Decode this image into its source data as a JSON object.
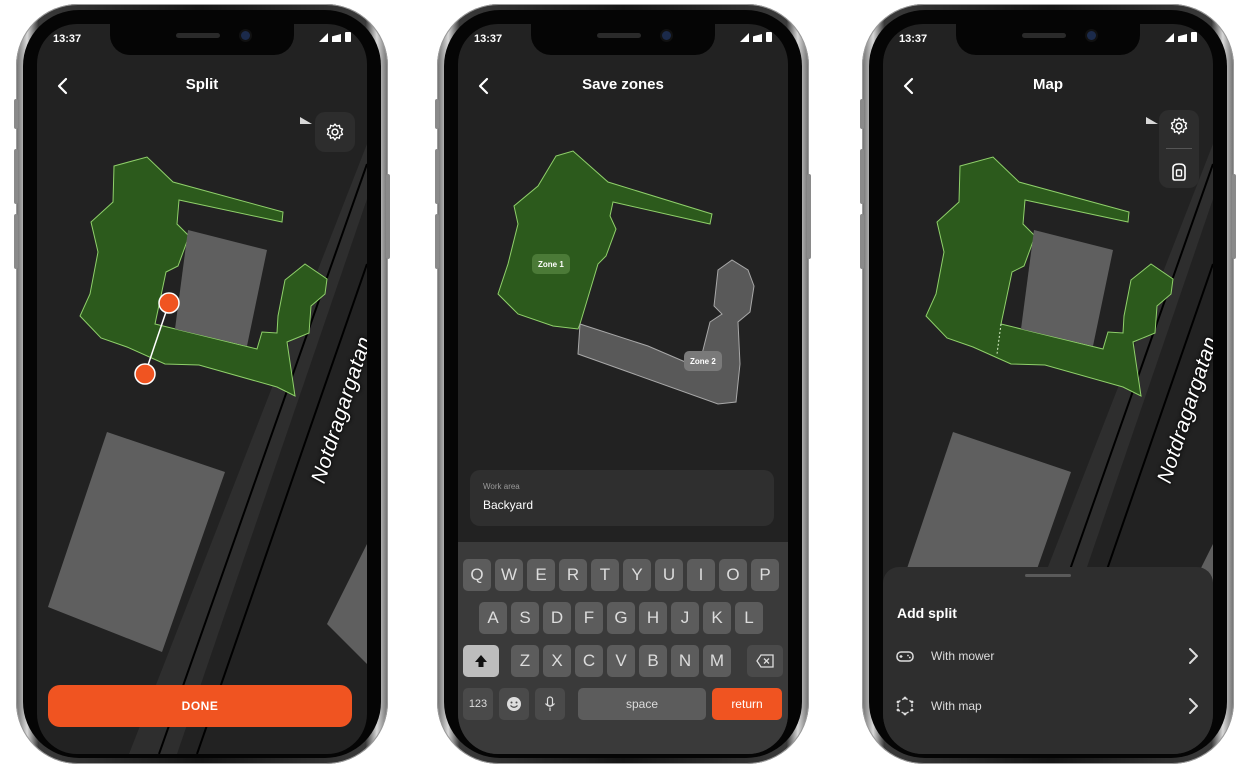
{
  "phones": [
    {
      "status_time": "13:37",
      "title": "Split",
      "street_name": "Notdragargatan",
      "done_label": "DONE"
    },
    {
      "status_time": "13:37",
      "title": "Save zones",
      "zone1_label": "Zone 1",
      "zone2_label": "Zone 2",
      "work_area": {
        "label": "Work area",
        "value": "Backyard"
      },
      "keyboard": {
        "row1": [
          "Q",
          "W",
          "E",
          "R",
          "T",
          "Y",
          "U",
          "I",
          "O",
          "P"
        ],
        "row2": [
          "A",
          "S",
          "D",
          "F",
          "G",
          "H",
          "J",
          "K",
          "L"
        ],
        "row3": [
          "Z",
          "X",
          "C",
          "V",
          "B",
          "N",
          "M"
        ],
        "numbers_key": "123",
        "space_key": "space",
        "return_key": "return"
      }
    },
    {
      "status_time": "13:37",
      "title": "Map",
      "street_name": "Notdragargatan",
      "sheet": {
        "title": "Add split",
        "options": [
          {
            "label": "With mower",
            "icon": "gamepad-icon"
          },
          {
            "label": "With map",
            "icon": "polygon-icon"
          }
        ]
      }
    }
  ],
  "colors": {
    "accent": "#f05421",
    "lawn": "#2c5a1c",
    "lawn_stroke": "#8fd06a",
    "background": "#222222"
  }
}
